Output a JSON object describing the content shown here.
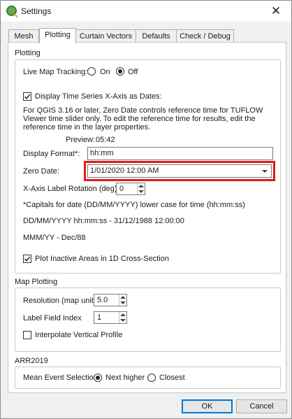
{
  "window": {
    "title": "Settings"
  },
  "tabs": [
    {
      "label": "Mesh"
    },
    {
      "label": "Plotting",
      "active": true
    },
    {
      "label": "Curtain Vectors"
    },
    {
      "label": "Defaults"
    },
    {
      "label": "Check / Debug"
    }
  ],
  "plotting": {
    "title": "Plotting",
    "live_map_tracking": {
      "label": "Live Map Tracking:",
      "on_label": "On",
      "off_label": "Off",
      "selected": "Off"
    },
    "display_time_series": {
      "label": "Display Time Series X-Axis as Dates:",
      "checked": true
    },
    "info_text": "For QGIS 3.16 or later, Zero Date controls reference time for TUFLOW Viewer time slider only. To edit the reference time for results, edit the reference time in the layer properties.",
    "preview": {
      "label": "Preview:",
      "value": "05:42"
    },
    "display_format": {
      "label": "Display Format*:",
      "value": "hh:mm"
    },
    "zero_date": {
      "label": "Zero Date:",
      "value": "1/01/2020 12:00 AM"
    },
    "label_rotation": {
      "label": "X-Axis Label Rotation (deg):",
      "value": "0"
    },
    "note_capitals": "*Capitals for date (DD/MM/YYYY) lower case for time (hh:mm:ss)",
    "example_1": "DD/MM/YYYY hh:mm:ss - 31/12/1988 12:00:00",
    "example_2": "MMM/YY - Dec/88",
    "plot_inactive": {
      "label": "Plot Inactive Areas in 1D Cross-Section",
      "checked": true
    }
  },
  "map_plotting": {
    "title": "Map Plotting",
    "resolution": {
      "label": "Resolution (map units)",
      "value": "5.0"
    },
    "label_field_index": {
      "label": "Label Field Index",
      "value": "1"
    },
    "interpolate_vertical": {
      "label": "Interpolate Vertical Profile",
      "checked": false
    }
  },
  "arr2019": {
    "title": "ARR2019",
    "mean_event": {
      "label": "Mean Event Selection:",
      "next_higher_label": "Next higher",
      "closest_label": "Closest",
      "selected": "Next higher"
    }
  },
  "buttons": {
    "ok": "OK",
    "cancel": "Cancel"
  },
  "colors": {
    "highlight": "#e3191c",
    "accent": "#0078d7"
  }
}
